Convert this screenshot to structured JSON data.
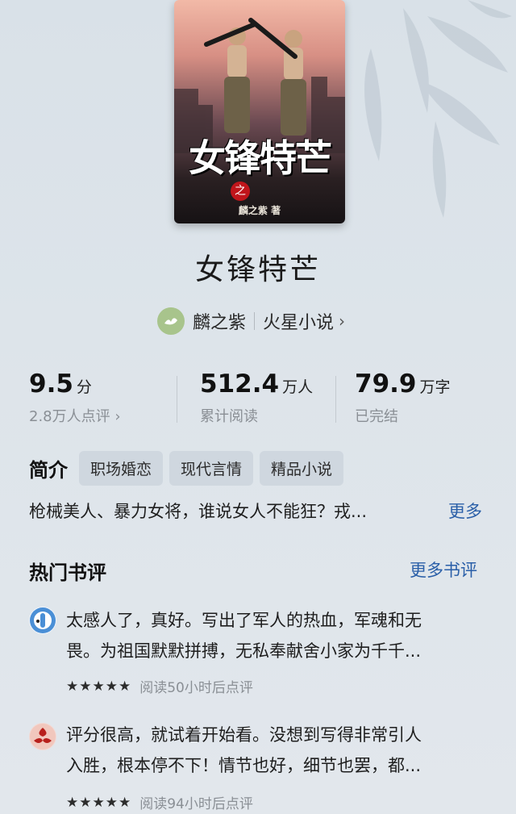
{
  "book": {
    "cover_title": "女锋特芒",
    "cover_badge": "之",
    "cover_author": "麟之紫 著",
    "title": "女锋特芒"
  },
  "author": {
    "name": "麟之紫",
    "publisher": "火星小说",
    "chevron": "›"
  },
  "stats": [
    {
      "value": "9.5",
      "unit": "分",
      "sub": "2.8万人点评 ›"
    },
    {
      "value": "512.4",
      "unit": "万人",
      "sub": "累计阅读"
    },
    {
      "value": "79.9",
      "unit": "万字",
      "sub": "已完结"
    }
  ],
  "intro": {
    "label": "简介",
    "tags": [
      "职场婚恋",
      "现代言情",
      "精品小说"
    ],
    "text": "枪械美人、暴力女将，谁说女人不能狂？戎...",
    "more": "更多"
  },
  "reviews_section": {
    "title": "热门书评",
    "more": "更多书评"
  },
  "reviews": [
    {
      "avatar_icon": "cartoon-avatar-icon",
      "line1": "太感人了，真好。写出了军人的热血，军魂和无",
      "line2": "畏。为祖国默默拼搏，无私奉献舍小家为千千...",
      "stars": "★★★★★",
      "meta": "阅读50小时后点评"
    },
    {
      "avatar_icon": "red-pattern-avatar-icon",
      "line1": "评分很高，就试着开始看。没想到写得非常引人",
      "line2": "入胜，根本停不下！情节也好，细节也罢，都...",
      "stars": "★★★★★",
      "meta": "阅读94小时后点评"
    }
  ],
  "colors": {
    "link": "#2a5fa8",
    "tag_bg": "#cfd7df",
    "muted": "#8a8f95"
  }
}
